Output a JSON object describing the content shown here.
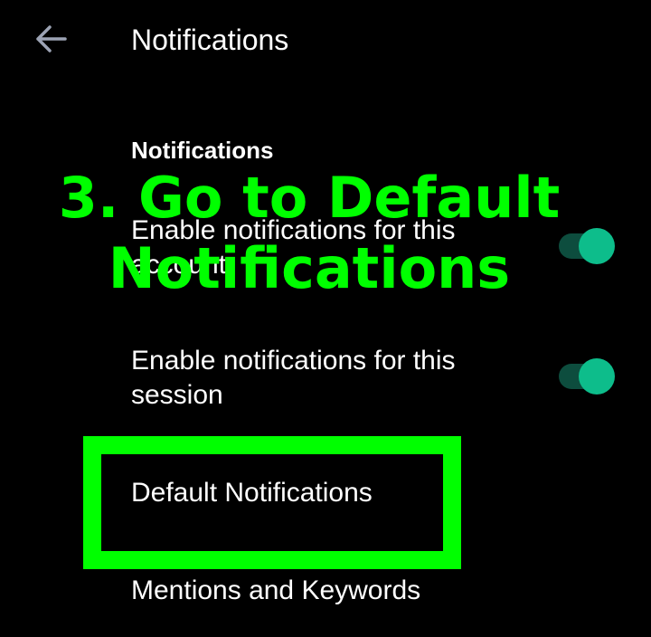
{
  "header": {
    "title": "Notifications",
    "back_icon": "arrow-left-icon"
  },
  "section": {
    "title": "Notifications"
  },
  "rows": [
    {
      "label": "Enable notifications for this account",
      "toggle_on": true
    },
    {
      "label": "Enable notifications for this session",
      "toggle_on": true
    },
    {
      "label": "Default Notifications"
    },
    {
      "label": "Mentions and Keywords"
    }
  ],
  "overlay": {
    "instruction": "3. Go to Default Notifications"
  },
  "colors": {
    "background": "#000000",
    "text": "#ffffff",
    "toggle_thumb": "#0dbd8b",
    "toggle_track": "#0d4d3e",
    "annotation": "#00ff00",
    "back_arrow": "#9ca3b4"
  }
}
